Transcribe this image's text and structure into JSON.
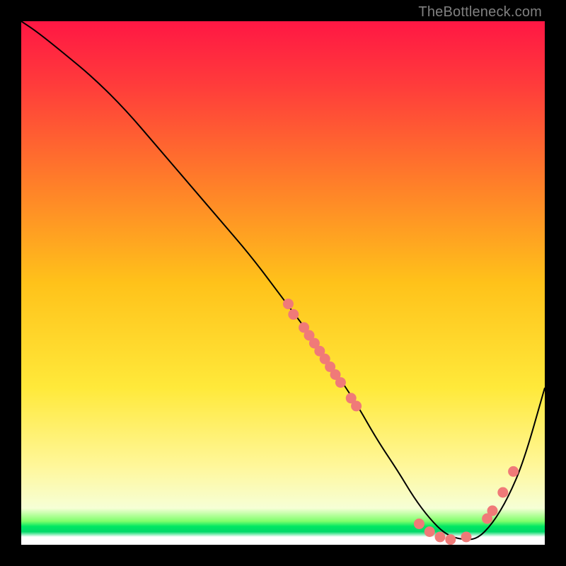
{
  "watermark": "TheBottleneck.com",
  "colors": {
    "bg": "#000000",
    "gradient_stops": [
      {
        "pos": 0.0,
        "color": "#ff1744"
      },
      {
        "pos": 0.12,
        "color": "#ff3b3b"
      },
      {
        "pos": 0.3,
        "color": "#ff7b2a"
      },
      {
        "pos": 0.5,
        "color": "#ffc21a"
      },
      {
        "pos": 0.7,
        "color": "#ffe93a"
      },
      {
        "pos": 0.85,
        "color": "#fff79a"
      },
      {
        "pos": 0.93,
        "color": "#f6ffd6"
      },
      {
        "pos": 0.955,
        "color": "#7fff6b"
      },
      {
        "pos": 0.965,
        "color": "#00e763"
      },
      {
        "pos": 0.975,
        "color": "#00d968"
      },
      {
        "pos": 0.985,
        "color": "#ffffff"
      },
      {
        "pos": 1.0,
        "color": "#ffffff"
      }
    ],
    "curve": "#000000",
    "dot": "#f07a78"
  },
  "chart_data": {
    "type": "line",
    "title": "",
    "xlabel": "",
    "ylabel": "",
    "xlim": [
      0,
      100
    ],
    "ylim": [
      0,
      100
    ],
    "annotations": [],
    "legend": [],
    "series": [
      {
        "name": "curve",
        "x": [
          0,
          3,
          8,
          14,
          20,
          26,
          32,
          38,
          44,
          50,
          56,
          60,
          64,
          68,
          72,
          75,
          78,
          81,
          84,
          87,
          90,
          93,
          96,
          100
        ],
        "y": [
          100,
          98,
          94,
          89,
          83,
          76,
          69,
          62,
          55,
          47,
          39,
          33,
          27,
          20,
          14,
          9,
          5,
          2,
          1,
          1,
          4,
          9,
          16,
          30
        ]
      }
    ],
    "scatter": [
      {
        "name": "dots",
        "points": [
          {
            "x": 51,
            "y": 46
          },
          {
            "x": 52,
            "y": 44
          },
          {
            "x": 54,
            "y": 41.5
          },
          {
            "x": 55,
            "y": 40
          },
          {
            "x": 56,
            "y": 38.5
          },
          {
            "x": 57,
            "y": 37
          },
          {
            "x": 58,
            "y": 35.5
          },
          {
            "x": 59,
            "y": 34
          },
          {
            "x": 60,
            "y": 32.5
          },
          {
            "x": 61,
            "y": 31
          },
          {
            "x": 63,
            "y": 28
          },
          {
            "x": 64,
            "y": 26.5
          },
          {
            "x": 76,
            "y": 4
          },
          {
            "x": 78,
            "y": 2.5
          },
          {
            "x": 80,
            "y": 1.5
          },
          {
            "x": 82,
            "y": 1
          },
          {
            "x": 85,
            "y": 1.5
          },
          {
            "x": 89,
            "y": 5
          },
          {
            "x": 90,
            "y": 6.5
          },
          {
            "x": 92,
            "y": 10
          },
          {
            "x": 94,
            "y": 14
          }
        ]
      }
    ]
  }
}
